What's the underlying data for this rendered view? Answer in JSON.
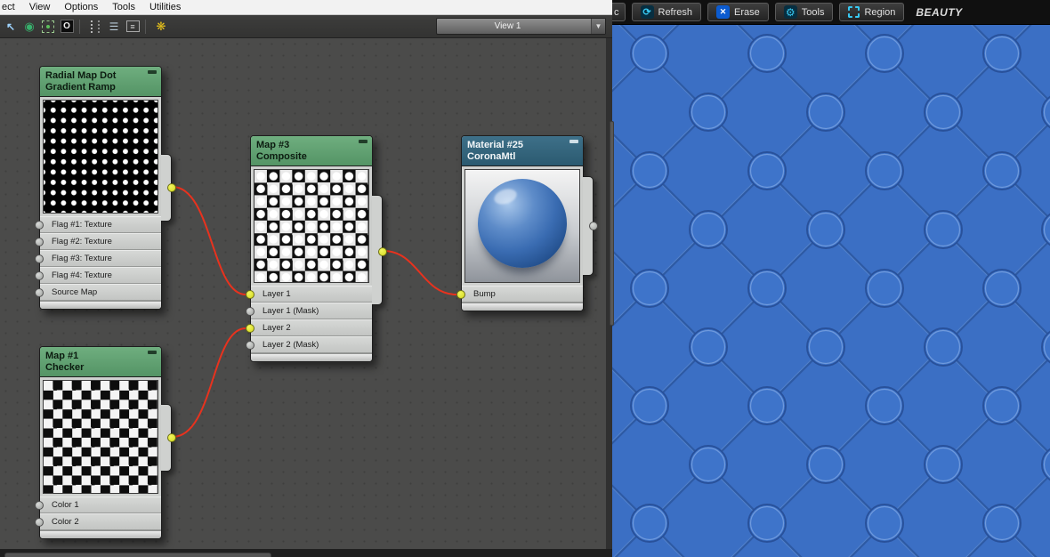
{
  "menu": {
    "items": [
      "ect",
      "View",
      "Options",
      "Tools",
      "Utilities"
    ]
  },
  "toolbar": {
    "view_label": "View 1",
    "dropdown_arrow": "▼",
    "icons": [
      {
        "name": "select-arrow-icon"
      },
      {
        "name": "pick-material-icon"
      },
      {
        "name": "region-marquee-icon"
      },
      {
        "name": "show-background-icon"
      },
      {
        "name": "move-children-icon"
      },
      {
        "name": "hide-unused-nodeslots-icon"
      },
      {
        "name": "layout-all-icon"
      },
      {
        "name": "render-map-icon"
      }
    ]
  },
  "nodes": [
    {
      "title": "Radial Map Dot",
      "subtitle": "Gradient Ramp",
      "output_connected": true,
      "slots": [
        {
          "label": "Flag #1: Texture",
          "connected": false
        },
        {
          "label": "Flag #2: Texture",
          "connected": false
        },
        {
          "label": "Flag #3: Texture",
          "connected": false
        },
        {
          "label": "Flag #4: Texture",
          "connected": false
        },
        {
          "label": "Source Map",
          "connected": false
        }
      ]
    },
    {
      "title": "Map #3",
      "subtitle": "Composite",
      "output_connected": true,
      "slots": [
        {
          "label": "Layer 1",
          "connected": true
        },
        {
          "label": "Layer 1 (Mask)",
          "connected": false
        },
        {
          "label": "Layer 2",
          "connected": true
        },
        {
          "label": "Layer 2 (Mask)",
          "connected": false
        }
      ]
    },
    {
      "title": "Material #25",
      "subtitle": "CoronaMtl",
      "output_connected": false,
      "slots": [
        {
          "label": "Bump",
          "connected": true
        }
      ]
    },
    {
      "title": "Map #1",
      "subtitle": "Checker",
      "output_connected": true,
      "slots": [
        {
          "label": "Color 1",
          "connected": false
        },
        {
          "label": "Color 2",
          "connected": false
        }
      ]
    }
  ],
  "render_toolbar": {
    "clipped_label": "c",
    "buttons": [
      {
        "label": "Refresh",
        "icon": "refresh-icon"
      },
      {
        "label": "Erase",
        "icon": "erase-icon"
      },
      {
        "label": "Tools",
        "icon": "tools-icon"
      },
      {
        "label": "Region",
        "icon": "region-icon"
      }
    ],
    "pass_label": "BEAUTY"
  },
  "colors": {
    "map_header_green": "#5d9f6f",
    "material_header_blue": "#34657c",
    "wire_red": "#e8321e",
    "connector_yellow": "#dce02a",
    "render_blue": "#3b6fc4",
    "canvas_gray": "#4b4b4a"
  }
}
